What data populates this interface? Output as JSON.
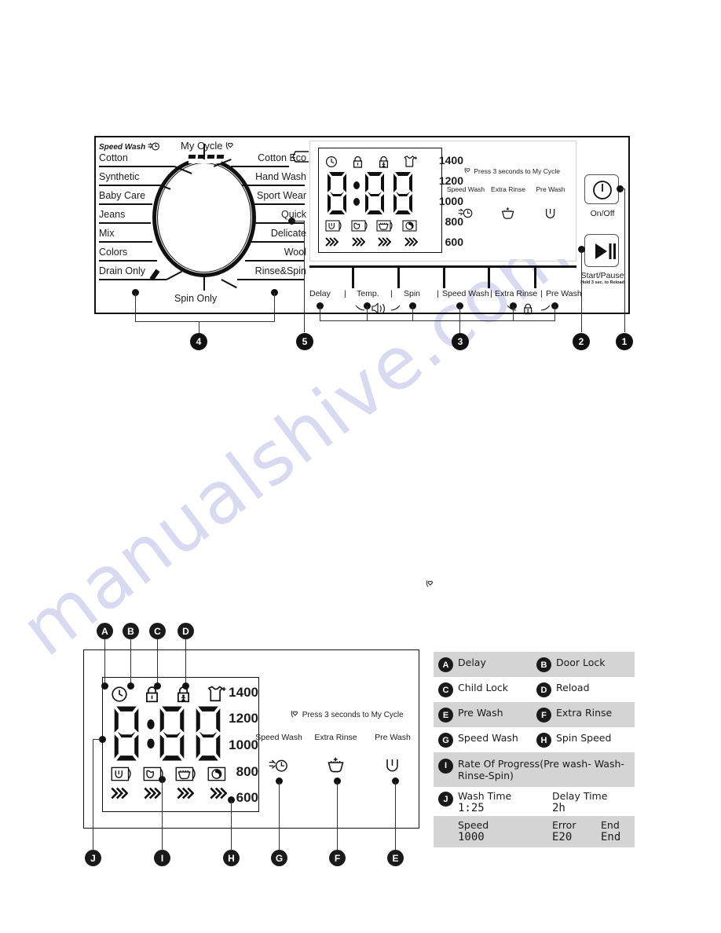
{
  "document": {
    "watermark": "manualshive.com"
  },
  "control_panel": {
    "speed_wash_label": "Speed Wash",
    "my_cycle_label": "My Cycle",
    "spin_only_label": "Spin Only",
    "cycles_left": [
      "Cotton",
      "Synthetic",
      "Baby Care",
      "Jeans",
      "Mix",
      "Colors",
      "Drain Only"
    ],
    "cycles_right": [
      "Cotton Eco",
      "Hand Wash",
      "Sport Wear",
      "Quick",
      "Delicate",
      "Wool",
      "Rinse&Spin"
    ],
    "display": {
      "status_icons": [
        "delay-clock-icon",
        "door-lock-icon",
        "child-lock-icon",
        "reload-shirt-icon"
      ],
      "segment_value": "8:88",
      "wash_stage_icons": [
        "prewash-icon",
        "wash-icon",
        "rinse-icon",
        "spin-icon"
      ],
      "progress_arrows": 4,
      "spin_speeds": [
        "1400",
        "1200",
        "1000",
        "800",
        "600"
      ],
      "my_cycle_hint": "Press 3 seconds to My Cycle",
      "options": [
        {
          "label": "Speed Wash",
          "icon": "speed-wash-icon"
        },
        {
          "label": "Extra Rinse",
          "icon": "extra-rinse-icon"
        },
        {
          "label": "Pre Wash",
          "icon": "pre-wash-icon"
        }
      ]
    },
    "buttons": [
      "Delay",
      "Temp.",
      "Spin",
      "Speed Wash",
      "Extra Rinse",
      "Pre Wash"
    ],
    "button_extra_icons": {
      "spin": "my-cycle-heart-icon",
      "temp_sound": "volume-icon",
      "extra_rinse_childlock": "child-lock-icon"
    },
    "power": {
      "on_off_label": "On/Off",
      "start_pause_label": "Start/Pause",
      "start_pause_sub": "Hold 3 sec. to Reload"
    },
    "callouts": [
      "1",
      "2",
      "3",
      "4",
      "5"
    ]
  },
  "lower_diagram": {
    "top_callouts": [
      "A",
      "B",
      "C",
      "D"
    ],
    "bottom_callouts": [
      "J",
      "I",
      "H",
      "G",
      "F",
      "E"
    ],
    "display": {
      "segment_value": "8:88",
      "spin_speeds": [
        "1400",
        "1200",
        "1000",
        "800",
        "600"
      ],
      "my_cycle_hint": "Press 3 seconds to My Cycle",
      "options": [
        {
          "label": "Speed Wash",
          "icon": "speed-wash-icon"
        },
        {
          "label": "Extra Rinse",
          "icon": "extra-rinse-icon"
        },
        {
          "label": "Pre Wash",
          "icon": "pre-wash-icon"
        }
      ]
    }
  },
  "legend": {
    "rows": [
      {
        "shade": "g",
        "left": {
          "key": "A",
          "text": "Delay"
        },
        "right": {
          "key": "B",
          "text": "Door Lock"
        }
      },
      {
        "shade": "w",
        "left": {
          "key": "C",
          "text": "Child Lock"
        },
        "right": {
          "key": "D",
          "text": "Reload"
        }
      },
      {
        "shade": "g",
        "left": {
          "key": "E",
          "text": "Pre Wash"
        },
        "right": {
          "key": "F",
          "text": "Extra Rinse"
        }
      },
      {
        "shade": "w",
        "left": {
          "key": "G",
          "text": "Speed Wash"
        },
        "right": {
          "key": "H",
          "text": "Spin Speed"
        }
      }
    ],
    "progress_row": {
      "key": "I",
      "text": "Rate Of Progress(Pre wash- Wash-Rinse-Spin)"
    },
    "values_row": {
      "key": "J",
      "wash_time_label": "Wash Time",
      "wash_time_value": "1:25",
      "delay_time_label": "Delay Time",
      "delay_time_value": "2h"
    },
    "status_row": {
      "speed_label": "Speed",
      "speed_value": "1000",
      "error_label": "Error",
      "error_value": "E20",
      "end_label": "End",
      "end_value": "End"
    }
  }
}
